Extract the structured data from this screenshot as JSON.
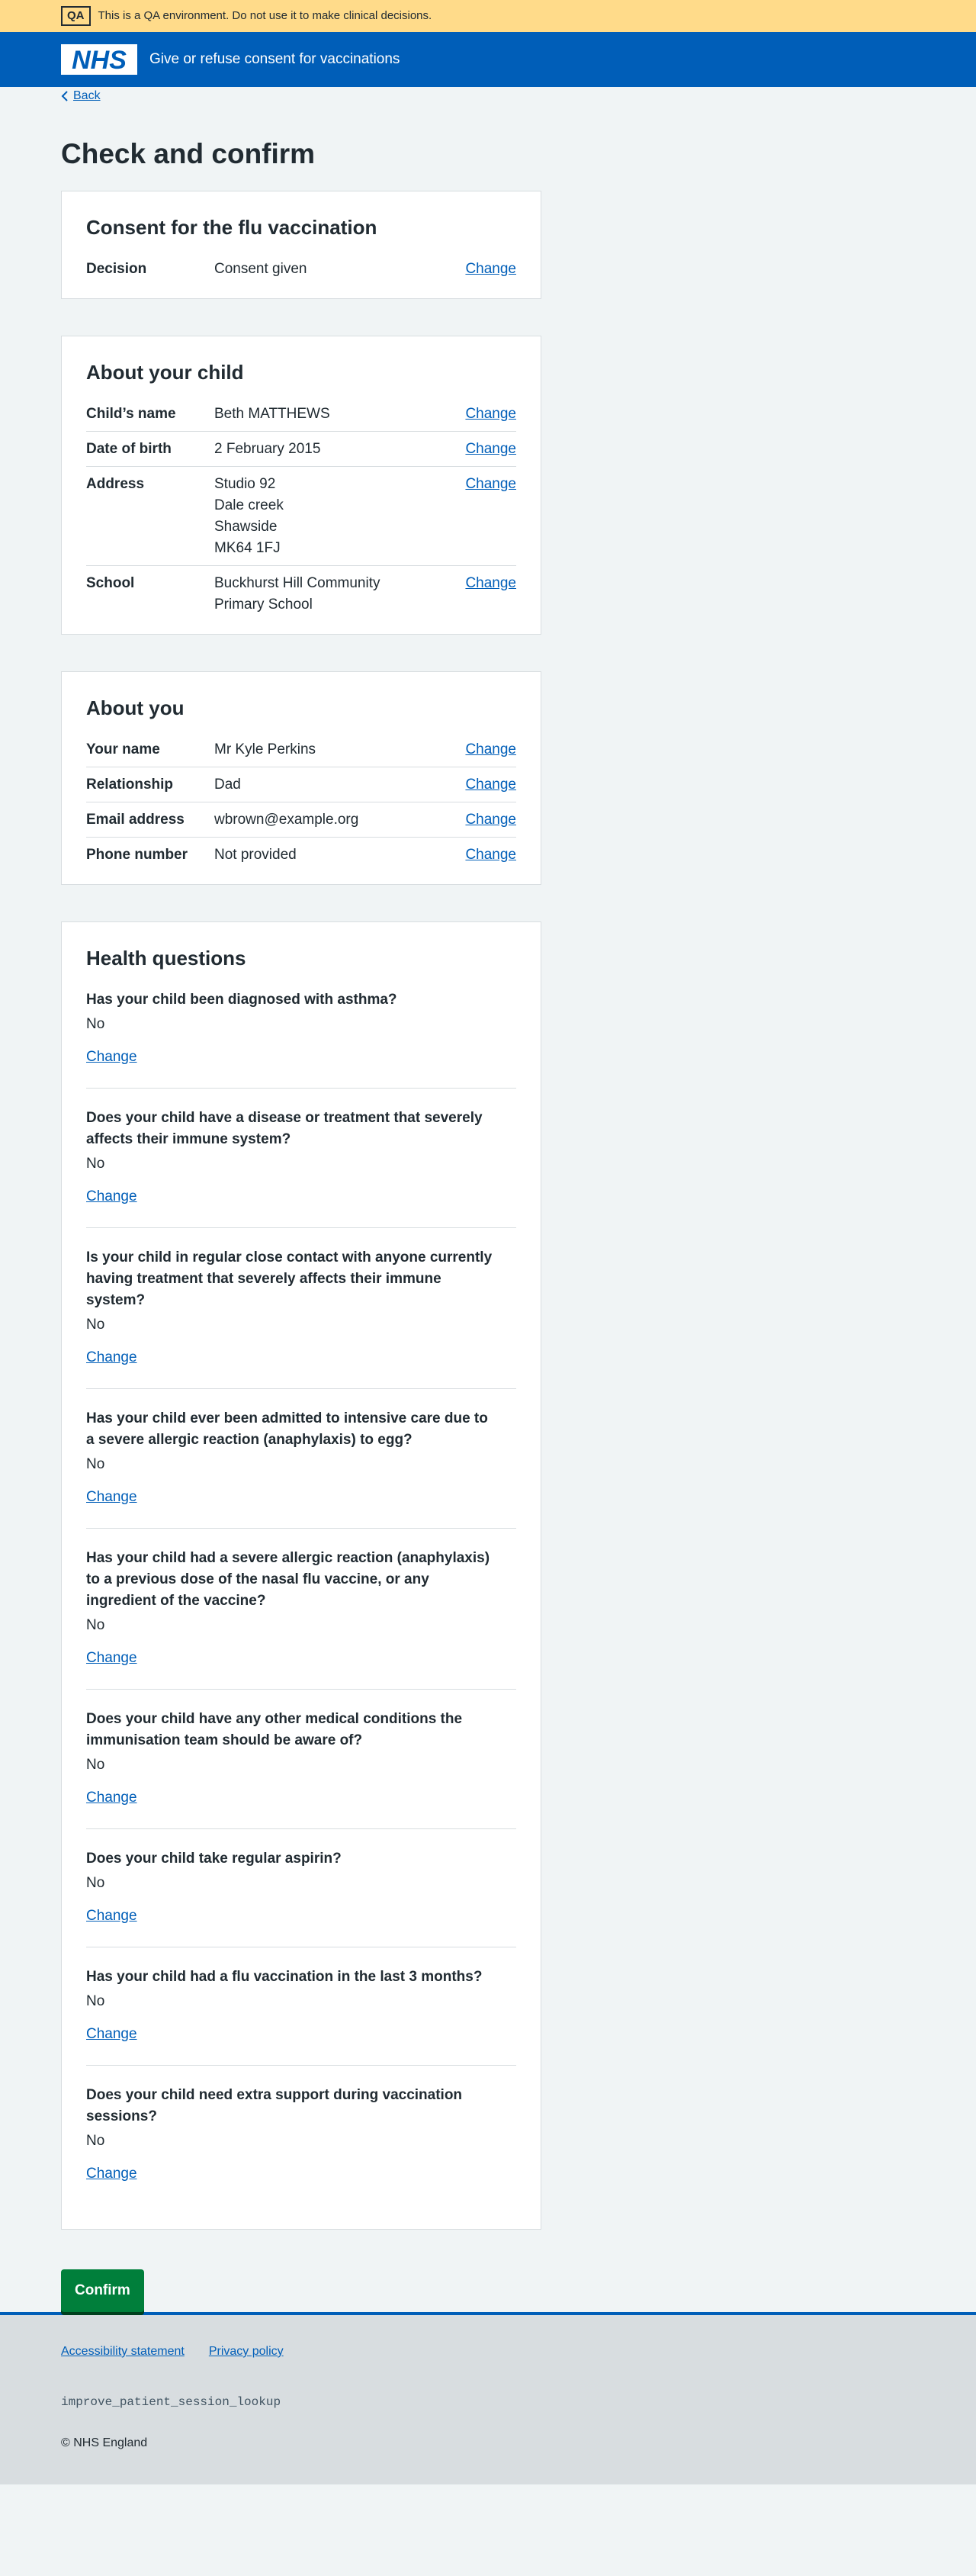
{
  "qa_banner": {
    "tag": "QA",
    "text": "This is a QA environment. Do not use it to make clinical decisions."
  },
  "header": {
    "logo_text": "NHS",
    "service_name": "Give or refuse consent for vaccinations"
  },
  "back_link": "Back",
  "page_title": "Check and confirm",
  "cards": {
    "consent": {
      "title": "Consent for the flu vaccination",
      "rows": [
        {
          "key": "Decision",
          "value": [
            "Consent given"
          ],
          "action": "Change"
        }
      ]
    },
    "child": {
      "title": "About your child",
      "rows": [
        {
          "key": "Child’s name",
          "value": [
            "Beth MATTHEWS"
          ],
          "action": "Change"
        },
        {
          "key": "Date of birth",
          "value": [
            "2 February 2015"
          ],
          "action": "Change"
        },
        {
          "key": "Address",
          "value": [
            "Studio 92",
            "Dale creek",
            "Shawside",
            "MK64 1FJ"
          ],
          "action": "Change"
        },
        {
          "key": "School",
          "value": [
            "Buckhurst Hill Community",
            "Primary School"
          ],
          "action": "Change"
        }
      ]
    },
    "you": {
      "title": "About you",
      "rows": [
        {
          "key": "Your name",
          "value": [
            "Mr Kyle Perkins"
          ],
          "action": "Change"
        },
        {
          "key": "Relationship",
          "value": [
            "Dad"
          ],
          "action": "Change"
        },
        {
          "key": "Email address",
          "value": [
            "wbrown@example.org"
          ],
          "action": "Change"
        },
        {
          "key": "Phone number",
          "value": [
            "Not provided"
          ],
          "action": "Change"
        }
      ]
    }
  },
  "health": {
    "title": "Health questions",
    "questions": [
      {
        "q": "Has your child been diagnosed with asthma?",
        "a": "No",
        "action": "Change"
      },
      {
        "q": "Does your child have a disease or treatment that severely affects their immune system?",
        "a": "No",
        "action": "Change"
      },
      {
        "q": "Is your child in regular close contact with anyone currently having treatment that severely affects their immune system?",
        "a": "No",
        "action": "Change"
      },
      {
        "q": "Has your child ever been admitted to intensive care due to a severe allergic reaction (anaphylaxis) to egg?",
        "a": "No",
        "action": "Change"
      },
      {
        "q": "Has your child had a severe allergic reaction (anaphylaxis) to a previous dose of the nasal flu vaccine, or any ingredient of the vaccine?",
        "a": "No",
        "action": "Change"
      },
      {
        "q": "Does your child have any other medical conditions the immunisation team should be aware of?",
        "a": "No",
        "action": "Change"
      },
      {
        "q": "Does your child take regular aspirin?",
        "a": "No",
        "action": "Change"
      },
      {
        "q": "Has your child had a flu vaccination in the last 3 months?",
        "a": "No",
        "action": "Change"
      },
      {
        "q": "Does your child need extra support during vaccination sessions?",
        "a": "No",
        "action": "Change"
      }
    ]
  },
  "confirm_button": "Confirm",
  "footer": {
    "links": [
      "Accessibility statement",
      "Privacy policy"
    ],
    "code": "improve_patient_session_lookup",
    "copyright": "© NHS England"
  },
  "colors": {
    "nhs_blue": "#005eb8",
    "qa_banner": "#ffdb8a",
    "button_green": "#007f3b",
    "page_bg": "#f0f4f5"
  }
}
